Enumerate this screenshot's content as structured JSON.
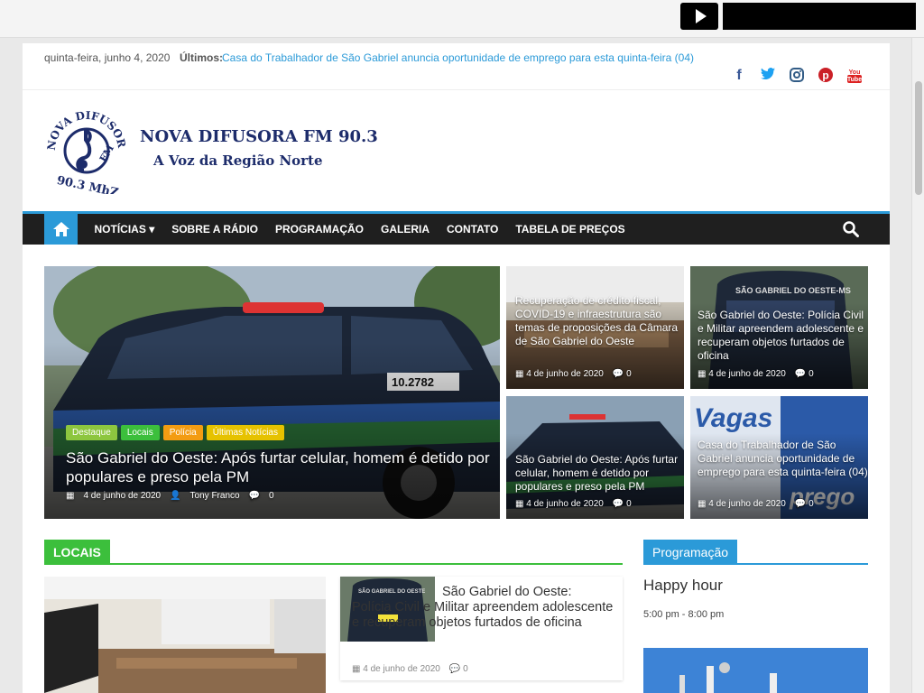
{
  "topbar": {
    "date": "quinta-feira, junho 4, 2020",
    "latest_label": "Últimos:",
    "latest_link": "Casa do Trabalhador de São Gabriel anuncia oportunidade de emprego para esta quinta-feira (04)"
  },
  "social": [
    {
      "icon": "facebook-icon",
      "glyph": "f",
      "color": "#3b5998"
    },
    {
      "icon": "twitter-icon",
      "glyph": "t",
      "color": "#1da1f2"
    },
    {
      "icon": "instagram-icon",
      "glyph": "◎",
      "color": "#325c86"
    },
    {
      "icon": "pinterest-icon",
      "glyph": "P",
      "color": "#cb2027"
    },
    {
      "icon": "youtube-icon",
      "glyph": "▶",
      "color": "#d22"
    }
  ],
  "header": {
    "logo_text": "NOVA DIFUSORA FM 90.3 MhZ",
    "title": "NOVA DIFUSORA FM 90.3",
    "tagline": "A Voz da Região Norte"
  },
  "nav": {
    "items": [
      "NOTÍCIAS",
      "SOBRE A RÁDIO",
      "PROGRAMAÇÃO",
      "GALERIA",
      "CONTATO",
      "TABELA DE PREÇOS"
    ],
    "dropdown_indicator": "▾"
  },
  "featured": {
    "big": {
      "tags": [
        {
          "label": "Destaque",
          "color": "#8dc63f"
        },
        {
          "label": "Locais",
          "color": "#3cbf3c"
        },
        {
          "label": "Polícia",
          "color": "#f39c12"
        },
        {
          "label": "Últimas Notícias",
          "color": "#e6c200"
        }
      ],
      "title": "São Gabriel do Oeste: Após furtar celular, homem é detido por populares e preso pela PM",
      "date": "4 de junho de 2020",
      "author": "Tony Franco",
      "comments": "0"
    },
    "s1": {
      "title": "Recuperação de crédito fiscal, COVID-19 e infraestrutura são temas de proposições da Câmara de São Gabriel do Oeste",
      "date": "4 de junho de 2020",
      "comments": "0"
    },
    "s2": {
      "title": "São Gabriel do Oeste: Polícia Civil e Militar apreendem adolescente e recuperam objetos furtados de oficina",
      "date": "4 de junho de 2020",
      "comments": "0"
    },
    "s3": {
      "title": "São Gabriel do Oeste: Após furtar celular, homem é detido por populares e preso pela PM",
      "date": "4 de junho de 2020",
      "comments": "0"
    },
    "s4": {
      "title": "Casa do Trabalhador de São Gabriel anuncia oportunidade de emprego para esta quinta-feira (04)",
      "date": "4 de junho de 2020",
      "comments": "0"
    }
  },
  "locais": {
    "heading": "LOCAIS",
    "card_title": "São Gabriel do Oeste: Polícia Civil e Militar apreendem adolescente e recuperam objetos furtados de oficina",
    "card_date": "4 de junho de 2020",
    "card_comments": "0"
  },
  "programacao": {
    "heading": "Programação",
    "show": "Happy hour",
    "time": "5:00 pm - 8:00 pm"
  }
}
